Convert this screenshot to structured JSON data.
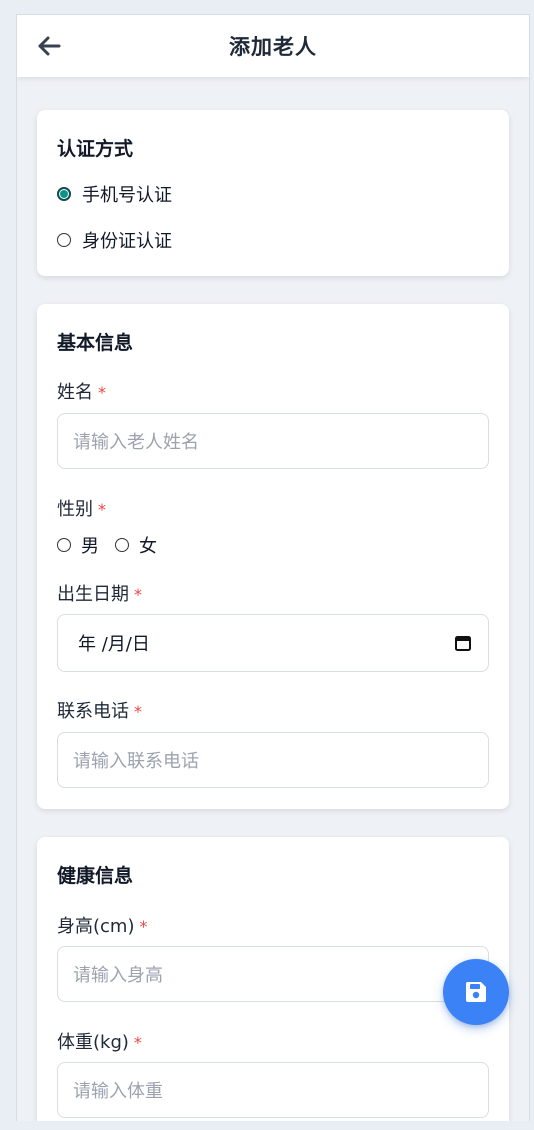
{
  "header": {
    "title": "添加老人",
    "back_icon": "arrow-left-icon"
  },
  "auth": {
    "title": "认证方式",
    "options": [
      {
        "label": "手机号认证",
        "checked": true
      },
      {
        "label": "身份证认证",
        "checked": false
      }
    ]
  },
  "basic": {
    "title": "基本信息",
    "name_label": "姓名",
    "name_placeholder": "请输入老人姓名",
    "gender_label": "性别",
    "gender_options": [
      "男",
      "女"
    ],
    "birth_label": "出生日期",
    "birth_value": "年 /月/日",
    "phone_label": "联系电话",
    "phone_placeholder": "请输入联系电话",
    "required_mark": "*"
  },
  "health": {
    "title": "健康信息",
    "height_label": "身高(cm)",
    "height_placeholder": "请输入身高",
    "weight_label": "体重(kg)",
    "weight_placeholder": "请输入体重"
  },
  "fab": {
    "icon": "save-icon"
  },
  "colors": {
    "accent": "#3b82f6",
    "radio_checked": "#0d9488",
    "required": "#ef4444",
    "background": "#eef1f5"
  }
}
